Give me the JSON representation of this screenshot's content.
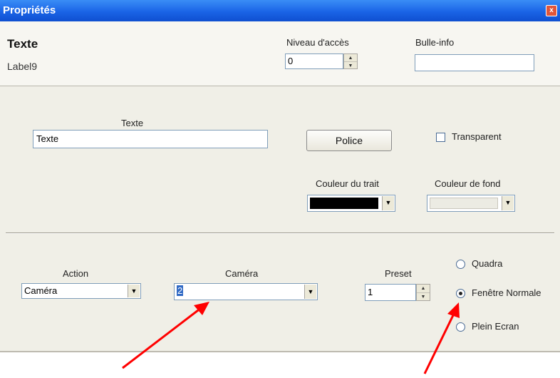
{
  "window": {
    "title": "Propriétés",
    "close_glyph": "x"
  },
  "header": {
    "heading": "Texte",
    "name": "Label9",
    "niveau_label": "Niveau d'accès",
    "niveau_value": "0",
    "bulle_label": "Bulle-info",
    "bulle_value": ""
  },
  "text_section": {
    "texte_label": "Texte",
    "texte_value": "Texte",
    "police_button": "Police",
    "transparent_label": "Transparent",
    "couleur_trait_label": "Couleur du trait",
    "couleur_fond_label": "Couleur de fond",
    "couleur_trait_color": "#000000",
    "couleur_fond_color": "#ecebe3"
  },
  "action_section": {
    "action_label": "Action",
    "action_value": "Caméra",
    "camera_label": "Caméra",
    "camera_value": "2",
    "preset_label": "Preset",
    "preset_value": "1",
    "radio_quadra": "Quadra",
    "radio_fenetre": "Fenêtre Normale",
    "radio_plein": "Plein Ecran",
    "selected_mode": "Fenêtre Normale"
  },
  "annotations": {
    "arrow_color": "#ff0000"
  }
}
